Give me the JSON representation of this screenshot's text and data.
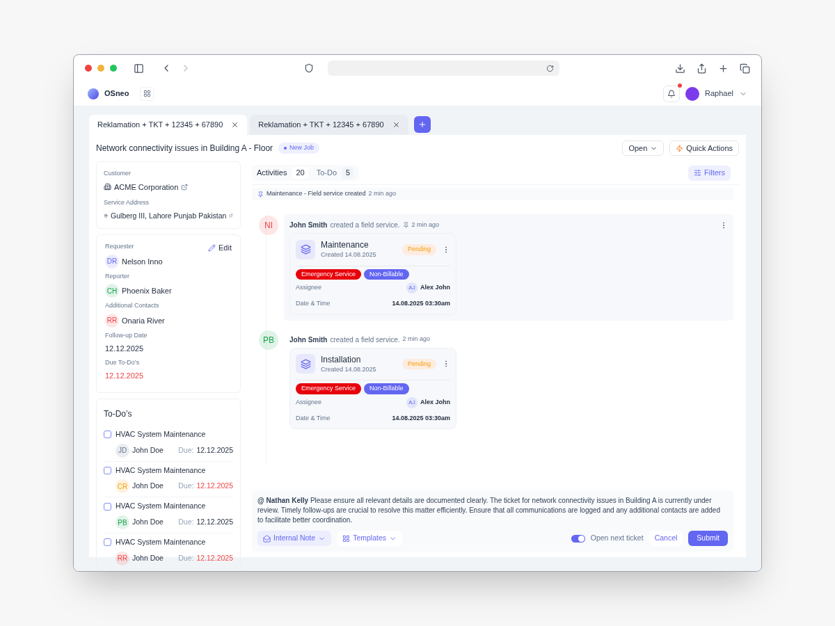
{
  "app": {
    "brand": "OSneo",
    "user": "Raphael",
    "notifications_unread": true
  },
  "tabs": [
    {
      "label": "Reklamation + TKT + 12345 + 67890",
      "selected": true
    },
    {
      "label": "Reklamation + TKT + 12345 + 67890",
      "selected": false
    }
  ],
  "ticket": {
    "title": "Network connectivity issues in Building A - Floor",
    "badge": "New Job",
    "status": "Open",
    "quick_actions": "Quick Actions"
  },
  "customer": {
    "label": "Customer",
    "name": "ACME Corporation",
    "address_label": "Service Address",
    "address": "Gulberg III, Lahore Punjab Pakistan"
  },
  "contacts": {
    "edit": "Edit",
    "fields": [
      {
        "kind": "person",
        "label": "Requester",
        "initials": "DR",
        "name": "Nelson Inno",
        "color": "#6366f1"
      },
      {
        "kind": "person",
        "label": "Reporter",
        "initials": "CH",
        "name": "Phoenix Baker",
        "color": "#16a34a"
      },
      {
        "kind": "person",
        "label": "Additional Contacts",
        "initials": "RR",
        "name": "Onaria River",
        "color": "#ef4444"
      },
      {
        "kind": "date",
        "label": "Follow-up Date",
        "value": "12.12.2025",
        "overdue": false
      },
      {
        "kind": "date",
        "label": "Due To-Do’s",
        "value": "12.12.2025",
        "overdue": true
      }
    ]
  },
  "todos": {
    "title": "To-Do’s",
    "items": [
      {
        "title": "HVAC System Maintenance",
        "checked": false,
        "initials": "JD",
        "color": "#64748b",
        "assignee": "John Doe",
        "due_label": "Due:",
        "due": "12.12.2025",
        "overdue": false
      },
      {
        "title": "HVAC System Maintenance",
        "checked": false,
        "initials": "CR",
        "color": "#f59e0b",
        "assignee": "John Doe",
        "due_label": "Due:",
        "due": "12.12.2025",
        "overdue": true
      },
      {
        "title": "HVAC System Maintenance",
        "checked": false,
        "initials": "PB",
        "color": "#16a34a",
        "assignee": "John Doe",
        "due_label": "Due:",
        "due": "12.12.2025",
        "overdue": false
      },
      {
        "title": "HVAC System Maintenance",
        "checked": false,
        "initials": "RR",
        "color": "#ef4444",
        "assignee": "John Doe",
        "due_label": "Due:",
        "due": "12.12.2025",
        "overdue": true
      }
    ]
  },
  "activity_tabs": [
    {
      "label": "Activities",
      "count": "20",
      "selected": true
    },
    {
      "label": "To-Do",
      "count": "5",
      "selected": false
    }
  ],
  "filters": "Filters",
  "pinned": {
    "text": "Maintenance - Field service created",
    "time": "2 min ago"
  },
  "activities": [
    {
      "initials": "NI",
      "color": "#ef4444",
      "author": "John Smith",
      "action": "created a field service.",
      "pinned": true,
      "time": "2 min ago",
      "highlighted": true,
      "service": {
        "title": "Maintenance",
        "created": "Created 14.08.2025",
        "status": "Pending",
        "tags": [
          {
            "label": "Emergency Service",
            "color": "#e7000b"
          },
          {
            "label": "Non-Billable",
            "color": "#6366f1"
          }
        ],
        "assignee_label": "Assignee",
        "assignee_initials": "AJ",
        "assignee": "Alex John",
        "datetime_label": "Date & Time",
        "datetime": "14.08.2025 03:30am"
      }
    },
    {
      "initials": "PB",
      "color": "#16a34a",
      "author": "John Smith",
      "action": "created a field service.",
      "pinned": false,
      "time": "2 min ago",
      "highlighted": false,
      "service": {
        "title": "Installation",
        "created": "Created 14.08.2025",
        "status": "Pending",
        "tags": [
          {
            "label": "Emergency Service",
            "color": "#e7000b"
          },
          {
            "label": "Non-Billable",
            "color": "#6366f1"
          }
        ],
        "assignee_label": "Assignee",
        "assignee_initials": "AJ",
        "assignee": "Alex John",
        "datetime_label": "Date & Time",
        "datetime": "14.08.2025 03:30am"
      }
    }
  ],
  "composer": {
    "text": "**@ Nathan Kelly** Please ensure all relevant details are documented clearly. The ticket for network connectivity issues in Building A is currently under review. Timely follow-ups are crucial to resolve this matter efficiently. Ensure that all communications are logged and any additional contacts are added to facilitate better coordination.",
    "note_type": "Internal Note",
    "templates": "Templates",
    "open_next": {
      "label": "Open next ticket",
      "on": true
    },
    "cancel": "Cancel",
    "submit": "Submit"
  }
}
